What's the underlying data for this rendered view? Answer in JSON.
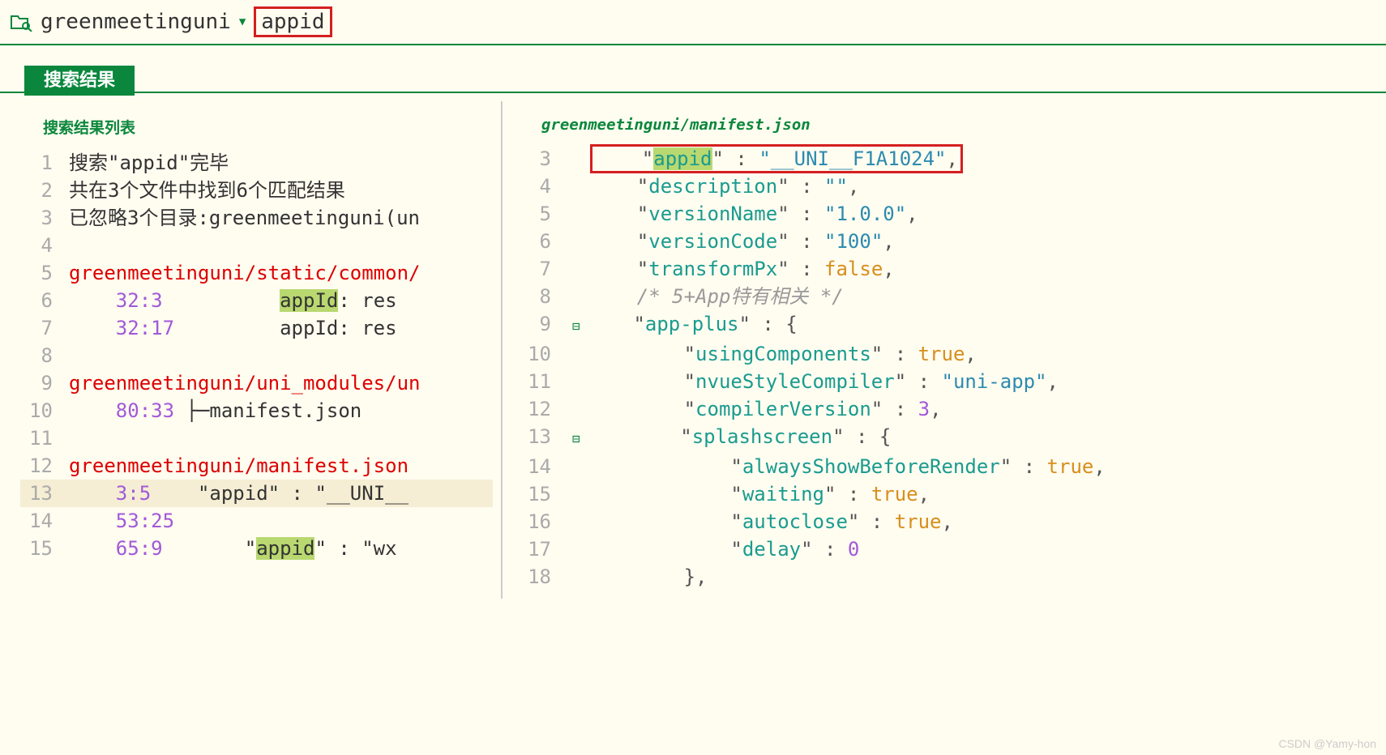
{
  "topbar": {
    "scope": "greenmeetinguni",
    "searchTerm": "appid"
  },
  "tabs": {
    "active": "搜索结果"
  },
  "leftPanel": {
    "header": "搜索结果列表",
    "lines": [
      {
        "n": "1",
        "parts": [
          {
            "t": "搜索\"",
            "c": ""
          },
          {
            "t": "appid",
            "c": ""
          },
          {
            "t": "\"完毕",
            "c": ""
          }
        ]
      },
      {
        "n": "2",
        "parts": [
          {
            "t": "共在3个文件中找到6个匹配结果",
            "c": ""
          }
        ]
      },
      {
        "n": "3",
        "parts": [
          {
            "t": "已忽略3个目录:greenmeetinguni(un",
            "c": ""
          }
        ]
      },
      {
        "n": "4",
        "parts": [
          {
            "t": "",
            "c": ""
          }
        ]
      },
      {
        "n": "5",
        "parts": [
          {
            "t": "greenmeetinguni/static/common/",
            "c": "red"
          }
        ]
      },
      {
        "n": "6",
        "parts": [
          {
            "t": "    ",
            "c": ""
          },
          {
            "t": "32:3",
            "c": "purple"
          },
          {
            "t": "          ",
            "c": ""
          },
          {
            "t": "appId",
            "c": "hl"
          },
          {
            "t": ": res",
            "c": ""
          }
        ]
      },
      {
        "n": "7",
        "parts": [
          {
            "t": "    ",
            "c": ""
          },
          {
            "t": "32:17",
            "c": "purple"
          },
          {
            "t": "         appId: res",
            "c": ""
          }
        ]
      },
      {
        "n": "8",
        "parts": [
          {
            "t": "",
            "c": ""
          }
        ]
      },
      {
        "n": "9",
        "parts": [
          {
            "t": "greenmeetinguni/uni_modules/un",
            "c": "red"
          }
        ]
      },
      {
        "n": "10",
        "parts": [
          {
            "t": "    ",
            "c": ""
          },
          {
            "t": "80:33",
            "c": "purple"
          },
          {
            "t": " ├─manifest.json",
            "c": ""
          }
        ]
      },
      {
        "n": "11",
        "parts": [
          {
            "t": "",
            "c": ""
          }
        ]
      },
      {
        "n": "12",
        "parts": [
          {
            "t": "greenmeetinguni/manifest.json",
            "c": "red"
          }
        ]
      },
      {
        "n": "13",
        "selected": true,
        "parts": [
          {
            "t": "    ",
            "c": ""
          },
          {
            "t": "3:5",
            "c": "purple"
          },
          {
            "t": "    \"appid\" : \"__UNI__",
            "c": ""
          }
        ]
      },
      {
        "n": "14",
        "parts": [
          {
            "t": "    ",
            "c": ""
          },
          {
            "t": "53:25",
            "c": "purple"
          }
        ]
      },
      {
        "n": "15",
        "parts": [
          {
            "t": "    ",
            "c": ""
          },
          {
            "t": "65:9",
            "c": "purple"
          },
          {
            "t": "       \"",
            "c": ""
          },
          {
            "t": "appid",
            "c": "hl"
          },
          {
            "t": "\" : \"wx",
            "c": ""
          }
        ]
      }
    ]
  },
  "rightPanel": {
    "header": "greenmeetinguni/manifest.json",
    "lines": [
      {
        "n": "3",
        "boxed": true,
        "parts": [
          {
            "t": "    \"",
            "c": "punct"
          },
          {
            "t": "appid",
            "c": "teal hl"
          },
          {
            "t": "\"",
            "c": "punct"
          },
          {
            "t": " : ",
            "c": "punct"
          },
          {
            "t": "\"__UNI__F1A1024\"",
            "c": "blue"
          },
          {
            "t": ",",
            "c": "punct"
          }
        ]
      },
      {
        "n": "4",
        "parts": [
          {
            "t": "    \"",
            "c": "punct"
          },
          {
            "t": "description",
            "c": "teal"
          },
          {
            "t": "\"",
            "c": "punct"
          },
          {
            "t": " : ",
            "c": "punct"
          },
          {
            "t": "\"\"",
            "c": "blue"
          },
          {
            "t": ",",
            "c": "punct"
          }
        ]
      },
      {
        "n": "5",
        "parts": [
          {
            "t": "    \"",
            "c": "punct"
          },
          {
            "t": "versionName",
            "c": "teal"
          },
          {
            "t": "\"",
            "c": "punct"
          },
          {
            "t": " : ",
            "c": "punct"
          },
          {
            "t": "\"1.0.0\"",
            "c": "blue"
          },
          {
            "t": ",",
            "c": "punct"
          }
        ]
      },
      {
        "n": "6",
        "parts": [
          {
            "t": "    \"",
            "c": "punct"
          },
          {
            "t": "versionCode",
            "c": "teal"
          },
          {
            "t": "\"",
            "c": "punct"
          },
          {
            "t": " : ",
            "c": "punct"
          },
          {
            "t": "\"100\"",
            "c": "blue"
          },
          {
            "t": ",",
            "c": "punct"
          }
        ]
      },
      {
        "n": "7",
        "parts": [
          {
            "t": "    \"",
            "c": "punct"
          },
          {
            "t": "transformPx",
            "c": "teal"
          },
          {
            "t": "\"",
            "c": "punct"
          },
          {
            "t": " : ",
            "c": "punct"
          },
          {
            "t": "false",
            "c": "lit-true"
          },
          {
            "t": ",",
            "c": "punct"
          }
        ]
      },
      {
        "n": "8",
        "parts": [
          {
            "t": "    /* 5+App特有相关 */",
            "c": "comment"
          }
        ]
      },
      {
        "n": "9",
        "fold": true,
        "parts": [
          {
            "t": "    \"",
            "c": "punct"
          },
          {
            "t": "app-plus",
            "c": "teal"
          },
          {
            "t": "\"",
            "c": "punct"
          },
          {
            "t": " : {",
            "c": "punct"
          }
        ]
      },
      {
        "n": "10",
        "parts": [
          {
            "t": "        \"",
            "c": "punct"
          },
          {
            "t": "usingComponents",
            "c": "teal"
          },
          {
            "t": "\"",
            "c": "punct"
          },
          {
            "t": " : ",
            "c": "punct"
          },
          {
            "t": "true",
            "c": "lit-true"
          },
          {
            "t": ",",
            "c": "punct"
          }
        ]
      },
      {
        "n": "11",
        "parts": [
          {
            "t": "        \"",
            "c": "punct"
          },
          {
            "t": "nvueStyleCompiler",
            "c": "teal"
          },
          {
            "t": "\"",
            "c": "punct"
          },
          {
            "t": " : ",
            "c": "punct"
          },
          {
            "t": "\"uni-app\"",
            "c": "blue"
          },
          {
            "t": ",",
            "c": "punct"
          }
        ]
      },
      {
        "n": "12",
        "parts": [
          {
            "t": "        \"",
            "c": "punct"
          },
          {
            "t": "compilerVersion",
            "c": "teal"
          },
          {
            "t": "\"",
            "c": "punct"
          },
          {
            "t": " : ",
            "c": "punct"
          },
          {
            "t": "3",
            "c": "num"
          },
          {
            "t": ",",
            "c": "punct"
          }
        ]
      },
      {
        "n": "13",
        "fold": true,
        "parts": [
          {
            "t": "        \"",
            "c": "punct"
          },
          {
            "t": "splashscreen",
            "c": "teal"
          },
          {
            "t": "\"",
            "c": "punct"
          },
          {
            "t": " : {",
            "c": "punct"
          }
        ]
      },
      {
        "n": "14",
        "parts": [
          {
            "t": "            \"",
            "c": "punct"
          },
          {
            "t": "alwaysShowBeforeRender",
            "c": "teal"
          },
          {
            "t": "\"",
            "c": "punct"
          },
          {
            "t": " : ",
            "c": "punct"
          },
          {
            "t": "true",
            "c": "lit-true"
          },
          {
            "t": ",",
            "c": "punct"
          }
        ]
      },
      {
        "n": "15",
        "parts": [
          {
            "t": "            \"",
            "c": "punct"
          },
          {
            "t": "waiting",
            "c": "teal"
          },
          {
            "t": "\"",
            "c": "punct"
          },
          {
            "t": " : ",
            "c": "punct"
          },
          {
            "t": "true",
            "c": "lit-true"
          },
          {
            "t": ",",
            "c": "punct"
          }
        ]
      },
      {
        "n": "16",
        "parts": [
          {
            "t": "            \"",
            "c": "punct"
          },
          {
            "t": "autoclose",
            "c": "teal"
          },
          {
            "t": "\"",
            "c": "punct"
          },
          {
            "t": " : ",
            "c": "punct"
          },
          {
            "t": "true",
            "c": "lit-true"
          },
          {
            "t": ",",
            "c": "punct"
          }
        ]
      },
      {
        "n": "17",
        "parts": [
          {
            "t": "            \"",
            "c": "punct"
          },
          {
            "t": "delay",
            "c": "teal"
          },
          {
            "t": "\"",
            "c": "punct"
          },
          {
            "t": " : ",
            "c": "punct"
          },
          {
            "t": "0",
            "c": "num"
          }
        ]
      },
      {
        "n": "18",
        "parts": [
          {
            "t": "        },",
            "c": "punct"
          }
        ]
      }
    ]
  },
  "watermark": "CSDN @Yamy-hon"
}
